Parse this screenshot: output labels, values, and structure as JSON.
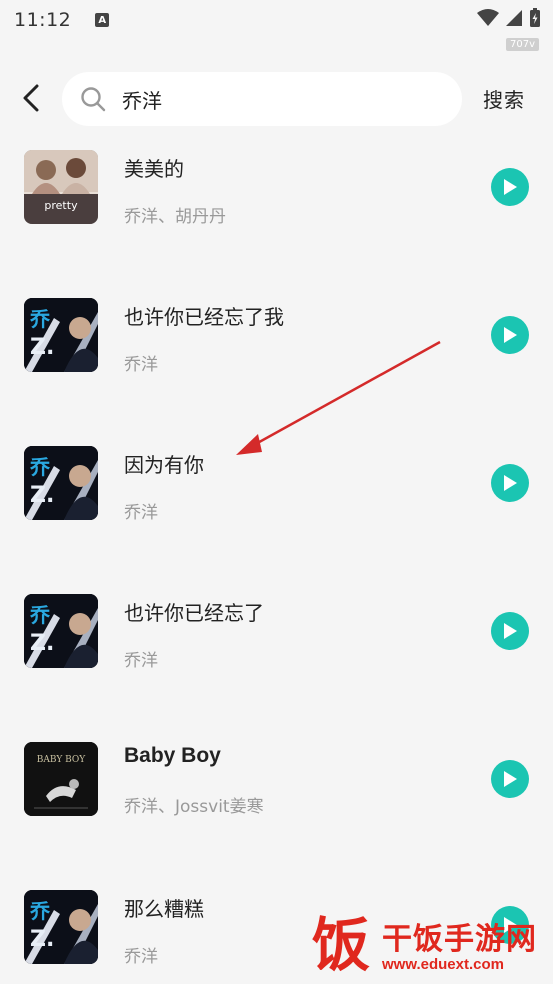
{
  "status_bar": {
    "time": "11:12",
    "a_icon_text": "A",
    "speed": "707v"
  },
  "header": {
    "search_value": "乔洋",
    "search_button": "搜索"
  },
  "songs": [
    {
      "title": "美美的",
      "artist": "乔洋、胡丹丹",
      "cover": "pretty",
      "cover_text": "pretty"
    },
    {
      "title": "也许你已经忘了我",
      "artist": "乔洋",
      "cover": "qiaoyang"
    },
    {
      "title": "因为有你",
      "artist": "乔洋",
      "cover": "qiaoyang"
    },
    {
      "title": "也许你已经忘了",
      "artist": "乔洋",
      "cover": "qiaoyang"
    },
    {
      "title": "Baby Boy",
      "artist": "乔洋、Jossvit姜寒",
      "cover": "babyboy",
      "cover_text": "BABY BOY"
    },
    {
      "title": "那么糟糕",
      "artist": "乔洋",
      "cover": "qiaoyang"
    }
  ],
  "watermark": {
    "logo_char": "饭",
    "name": "干饭手游网",
    "url": "www.eduext.com"
  },
  "colors": {
    "accent": "#1bc5b2",
    "arrow": "#d42a2a",
    "watermark": "#e0281e"
  }
}
